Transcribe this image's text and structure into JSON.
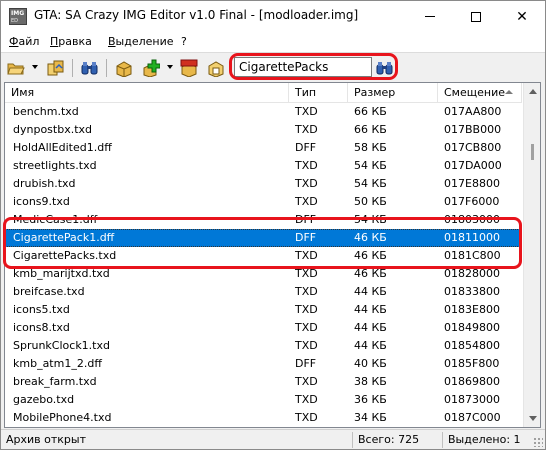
{
  "window": {
    "title": "GTA: SA Crazy IMG Editor v1.0 Final - [modloader.img]",
    "icon_text_top": "IMG",
    "icon_text_bottom": "ED",
    "minimize": "minimize-icon",
    "maximize": "maximize-icon",
    "close": "✕"
  },
  "menu": [
    {
      "label": "Файл",
      "underline": "Ф",
      "rest": "айл"
    },
    {
      "label": "Правка",
      "underline": "П",
      "rest": "равка"
    },
    {
      "label": "Выделение",
      "underline": "В",
      "rest": "ыделение"
    },
    {
      "label": "?",
      "underline": "",
      "rest": "?"
    }
  ],
  "toolbar": {
    "search_value": "CigarettePacks",
    "icons": [
      "open-folder-icon",
      "import-icon",
      "find-icon",
      "add-box-icon",
      "add-green-icon",
      "delete-box-icon",
      "rebuild-box-icon",
      "search-go-icon"
    ]
  },
  "columns": [
    "Имя",
    "Тип",
    "Размер",
    "Смещение"
  ],
  "rows": [
    {
      "name": "benchm.txd",
      "type": "TXD",
      "size": "66 КБ",
      "offset": "017AA800"
    },
    {
      "name": "dynpostbx.txd",
      "type": "TXD",
      "size": "66 КБ",
      "offset": "017BB000"
    },
    {
      "name": "HoldAllEdited1.dff",
      "type": "DFF",
      "size": "58 КБ",
      "offset": "017CB800"
    },
    {
      "name": "streetlights.txd",
      "type": "TXD",
      "size": "54 КБ",
      "offset": "017DA000"
    },
    {
      "name": "drubish.txd",
      "type": "TXD",
      "size": "54 КБ",
      "offset": "017E8800"
    },
    {
      "name": "icons9.txd",
      "type": "TXD",
      "size": "50 КБ",
      "offset": "017F6000"
    },
    {
      "name": "MedicCase1.dff",
      "type": "DFF",
      "size": "54 КБ",
      "offset": "01803000"
    },
    {
      "name": "CigarettePack1.dff",
      "type": "DFF",
      "size": "46 КБ",
      "offset": "01811000",
      "selected": true
    },
    {
      "name": "CigarettePacks.txd",
      "type": "TXD",
      "size": "46 КБ",
      "offset": "0181C800"
    },
    {
      "name": "kmb_marijtxd.txd",
      "type": "TXD",
      "size": "46 КБ",
      "offset": "01828000"
    },
    {
      "name": "breifcase.txd",
      "type": "TXD",
      "size": "44 КБ",
      "offset": "01833800"
    },
    {
      "name": "icons5.txd",
      "type": "TXD",
      "size": "44 КБ",
      "offset": "0183E800"
    },
    {
      "name": "icons8.txd",
      "type": "TXD",
      "size": "44 КБ",
      "offset": "01849800"
    },
    {
      "name": "SprunkClock1.txd",
      "type": "TXD",
      "size": "44 КБ",
      "offset": "01854800"
    },
    {
      "name": "kmb_atm1_2.dff",
      "type": "DFF",
      "size": "40 КБ",
      "offset": "0185F800"
    },
    {
      "name": "break_farm.txd",
      "type": "TXD",
      "size": "38 КБ",
      "offset": "01869800"
    },
    {
      "name": "gazebo.txd",
      "type": "TXD",
      "size": "36 КБ",
      "offset": "01873000"
    },
    {
      "name": "MobilePhone4.txd",
      "type": "TXD",
      "size": "34 КБ",
      "offset": "0187C000"
    }
  ],
  "status": {
    "left": "Архив открыт",
    "total": "Всего: 725",
    "selected": "Выделено: 1"
  },
  "colors": {
    "selection": "#0078d7",
    "highlight_outline": "#e8141c"
  }
}
